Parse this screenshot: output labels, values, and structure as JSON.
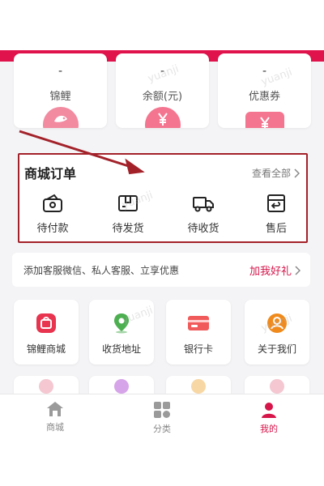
{
  "stats": [
    {
      "value": "-",
      "label": "锦鲤",
      "icon": "koi-icon"
    },
    {
      "value": "-",
      "label": "余额(元)",
      "icon": "yen-icon"
    },
    {
      "value": "-",
      "label": "优惠券",
      "icon": "coupon-icon"
    }
  ],
  "orders": {
    "title": "商城订单",
    "view_all": "查看全部",
    "items": [
      {
        "label": "待付款",
        "icon": "wallet-icon"
      },
      {
        "label": "待发货",
        "icon": "box-icon"
      },
      {
        "label": "待收货",
        "icon": "truck-icon"
      },
      {
        "label": "售后",
        "icon": "return-icon"
      }
    ]
  },
  "promo": {
    "text": "添加客服微信、私人客服、立享优惠",
    "cta": "加我好礼"
  },
  "services": [
    {
      "label": "锦鲤商城",
      "icon": "shop-icon",
      "color": "#e8344f"
    },
    {
      "label": "收货地址",
      "icon": "location-icon",
      "color": "#4caf50"
    },
    {
      "label": "银行卡",
      "icon": "bank-card-icon",
      "color": "#f15a5a"
    },
    {
      "label": "关于我们",
      "icon": "about-icon",
      "color": "#f08a1c"
    }
  ],
  "nav": [
    {
      "label": "商城",
      "icon": "home-icon"
    },
    {
      "label": "分类",
      "icon": "category-icon"
    },
    {
      "label": "我的",
      "icon": "profile-icon",
      "active": true
    }
  ],
  "colors": {
    "accent": "#e0134c",
    "outline": "#a3222a"
  },
  "watermark": "yuanji"
}
